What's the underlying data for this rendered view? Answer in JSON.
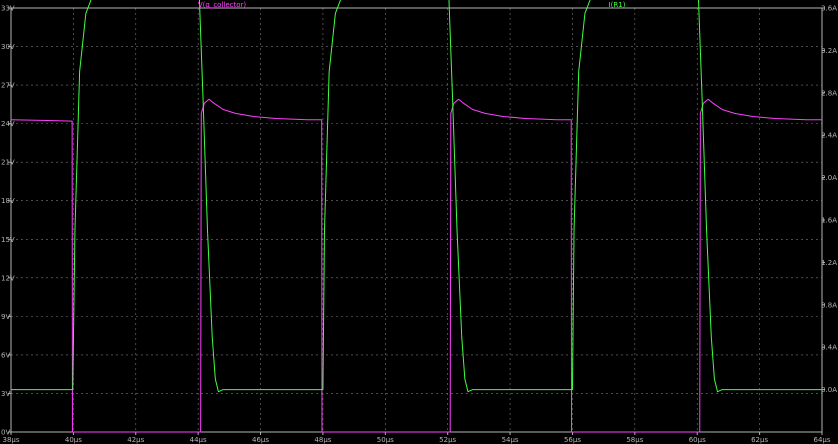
{
  "chart_data": {
    "type": "line",
    "background": "#000000",
    "grid": true,
    "grid_color": "#7a7a7a",
    "axis_color": "#b4b4b4",
    "x": {
      "range": [
        38,
        64
      ],
      "unit": "µs",
      "ticks": [
        "38µs",
        "40µs",
        "42µs",
        "44µs",
        "46µs",
        "48µs",
        "50µs",
        "52µs",
        "54µs",
        "56µs",
        "58µs",
        "60µs",
        "62µs",
        "64µs"
      ],
      "tick_values": [
        38,
        40,
        42,
        44,
        46,
        48,
        50,
        52,
        54,
        56,
        58,
        60,
        62,
        64
      ]
    },
    "y_left": {
      "range": [
        0,
        33
      ],
      "ticks": [
        "0V",
        "3V",
        "6V",
        "9V",
        "12V",
        "15V",
        "18V",
        "21V",
        "24V",
        "27V",
        "30V",
        "33V"
      ],
      "tick_values": [
        0,
        3,
        6,
        9,
        12,
        15,
        18,
        21,
        24,
        27,
        30,
        33
      ]
    },
    "y_right": {
      "range": [
        0,
        4
      ],
      "ticks": [
        "0.0A",
        "0.4A",
        "0.8A",
        "1.2A",
        "1.6A",
        "2.0A",
        "2.4A",
        "2.8A",
        "3.2A",
        "3.6A",
        "4.0A"
      ],
      "tick_values": [
        0,
        0.4,
        0.8,
        1.2,
        1.6,
        2.0,
        2.4,
        2.8,
        3.2,
        3.6,
        4.0
      ],
      "display_offset": 0.4
    },
    "series": [
      {
        "name": "V(q_collector)",
        "axis": "left",
        "color": "#ff40ff",
        "points": [
          [
            38,
            24.3
          ],
          [
            39,
            24.25
          ],
          [
            39.96,
            24.2
          ],
          [
            39.97,
            0.0
          ],
          [
            44.08,
            0.0
          ],
          [
            44.1,
            24.8
          ],
          [
            44.2,
            25.6
          ],
          [
            44.35,
            25.9
          ],
          [
            44.5,
            25.6
          ],
          [
            44.8,
            25.1
          ],
          [
            45.2,
            24.8
          ],
          [
            45.8,
            24.55
          ],
          [
            46.5,
            24.4
          ],
          [
            47.5,
            24.3
          ],
          [
            47.96,
            24.3
          ],
          [
            47.97,
            0.0
          ],
          [
            52.08,
            0.0
          ],
          [
            52.1,
            24.8
          ],
          [
            52.2,
            25.6
          ],
          [
            52.35,
            25.9
          ],
          [
            52.5,
            25.6
          ],
          [
            52.8,
            25.1
          ],
          [
            53.2,
            24.8
          ],
          [
            53.8,
            24.55
          ],
          [
            54.5,
            24.4
          ],
          [
            55.5,
            24.3
          ],
          [
            55.96,
            24.3
          ],
          [
            55.97,
            0.0
          ],
          [
            60.08,
            0.0
          ],
          [
            60.1,
            24.8
          ],
          [
            60.2,
            25.6
          ],
          [
            60.35,
            25.9
          ],
          [
            60.5,
            25.6
          ],
          [
            60.8,
            25.1
          ],
          [
            61.2,
            24.8
          ],
          [
            61.8,
            24.55
          ],
          [
            62.5,
            24.4
          ],
          [
            63.5,
            24.3
          ],
          [
            64,
            24.3
          ]
        ]
      },
      {
        "name": "I(R1)",
        "axis": "right",
        "color": "#40ff40",
        "points": [
          [
            38,
            0.0
          ],
          [
            39.98,
            0.0
          ],
          [
            40.05,
            1.5
          ],
          [
            40.2,
            3.0
          ],
          [
            40.4,
            3.55
          ],
          [
            40.7,
            3.78
          ],
          [
            41,
            3.84
          ],
          [
            41.5,
            3.87
          ],
          [
            42,
            3.88
          ],
          [
            44.02,
            3.88
          ],
          [
            44.05,
            3.6
          ],
          [
            44.15,
            2.8
          ],
          [
            44.3,
            1.5
          ],
          [
            44.45,
            0.5
          ],
          [
            44.55,
            0.1
          ],
          [
            44.65,
            -0.02
          ],
          [
            44.8,
            0.0
          ],
          [
            48,
            0.0
          ],
          [
            48.05,
            1.5
          ],
          [
            48.2,
            3.0
          ],
          [
            48.4,
            3.55
          ],
          [
            48.7,
            3.78
          ],
          [
            49,
            3.84
          ],
          [
            49.5,
            3.87
          ],
          [
            50,
            3.88
          ],
          [
            52.02,
            3.88
          ],
          [
            52.05,
            3.6
          ],
          [
            52.15,
            2.8
          ],
          [
            52.3,
            1.5
          ],
          [
            52.45,
            0.5
          ],
          [
            52.55,
            0.1
          ],
          [
            52.65,
            -0.02
          ],
          [
            52.8,
            0.0
          ],
          [
            56,
            0.0
          ],
          [
            56.05,
            1.5
          ],
          [
            56.2,
            3.0
          ],
          [
            56.4,
            3.55
          ],
          [
            56.7,
            3.78
          ],
          [
            57,
            3.84
          ],
          [
            57.5,
            3.87
          ],
          [
            58,
            3.88
          ],
          [
            60.02,
            3.88
          ],
          [
            60.05,
            3.6
          ],
          [
            60.15,
            2.8
          ],
          [
            60.3,
            1.5
          ],
          [
            60.45,
            0.5
          ],
          [
            60.55,
            0.1
          ],
          [
            60.65,
            -0.02
          ],
          [
            60.8,
            0.0
          ],
          [
            64,
            0.0
          ]
        ]
      }
    ]
  }
}
